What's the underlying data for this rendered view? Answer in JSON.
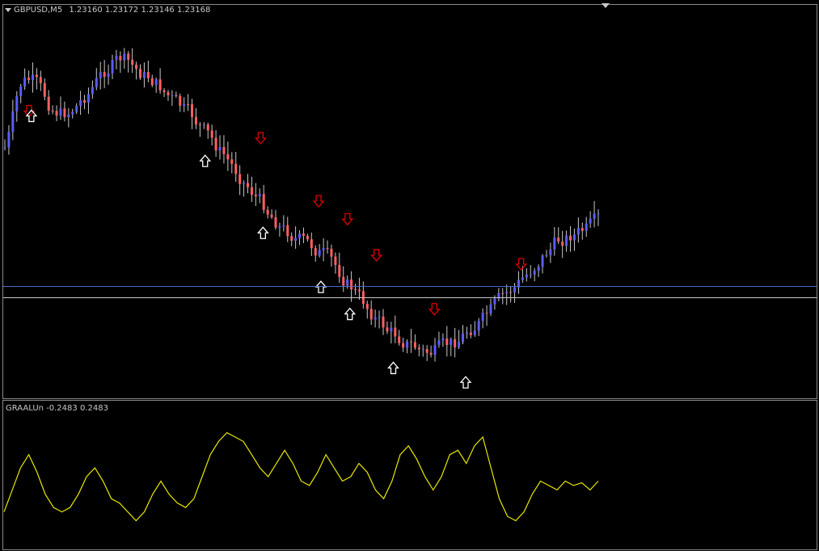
{
  "main_pane": {
    "symbol": "GBPUSD,M5",
    "ohlc": "1.23160 1.23172 1.23146 1.23168",
    "menu_arrow_icon": "triangle-down-icon",
    "shift_marker_icon": "triangle-down-icon"
  },
  "indicator_pane": {
    "label": "GRAALUn -0.2483 0.2483"
  },
  "colors": {
    "background": "#000000",
    "grid": "#8a8a8a",
    "bull_candle": "#5b5bff",
    "bear_candle": "#ff6060",
    "wick": "#c8c8c8",
    "sell_arrow": "#e00000",
    "buy_arrow": "#ffffff",
    "indicator_line": "#e8e800",
    "bid_line": "#4a6cc8",
    "ask_line": "#c8c8c8"
  },
  "chart_data": [
    {
      "type": "candlestick",
      "title": "GBPUSD,M5",
      "summary_levels": [
        0.0,
        0.4,
        0.36,
        0.22,
        0.18,
        0.25,
        0.35,
        0.45,
        0.5,
        0.42,
        0.38,
        0.3,
        0.22,
        0.15,
        0.05,
        -0.05,
        -0.15,
        -0.25,
        -0.35,
        -0.45,
        -0.5,
        -0.55,
        -0.6,
        -0.7,
        -0.8,
        -0.9,
        -1.0,
        -1.05,
        -1.1,
        -1.15,
        -1.12,
        -1.08,
        -1.0,
        -0.95,
        -0.85,
        -0.78,
        -0.7,
        -0.6,
        -0.52,
        -0.48,
        -0.46,
        -0.4
      ],
      "signals": {
        "sell_indices": [
          0,
          16,
          20,
          22,
          24,
          28,
          34
        ],
        "buy_indices": [
          1,
          13,
          17,
          21,
          23,
          26,
          31
        ]
      }
    },
    {
      "type": "line",
      "title": "GRAALUn -0.2483 0.2483",
      "series": [
        {
          "values": [
            0.05,
            0.3,
            0.55,
            0.7,
            0.5,
            0.25,
            0.1,
            0.05,
            0.1,
            0.25,
            0.45,
            0.55,
            0.4,
            0.2,
            0.15,
            0.05,
            -0.05,
            0.05,
            0.25,
            0.4,
            0.25,
            0.15,
            0.1,
            0.2,
            0.45,
            0.7,
            0.85,
            0.95,
            0.9,
            0.85,
            0.7,
            0.55,
            0.45,
            0.6,
            0.75,
            0.6,
            0.4,
            0.35,
            0.5,
            0.7,
            0.55,
            0.4,
            0.45,
            0.6,
            0.5,
            0.3,
            0.2,
            0.4,
            0.7,
            0.8,
            0.65,
            0.45,
            0.3,
            0.45,
            0.7,
            0.75,
            0.6,
            0.8,
            0.9,
            0.55,
            0.2,
            0.0,
            -0.05,
            0.05,
            0.25,
            0.4,
            0.35,
            0.3,
            0.4,
            0.35,
            0.38,
            0.3,
            0.4
          ]
        }
      ]
    }
  ]
}
